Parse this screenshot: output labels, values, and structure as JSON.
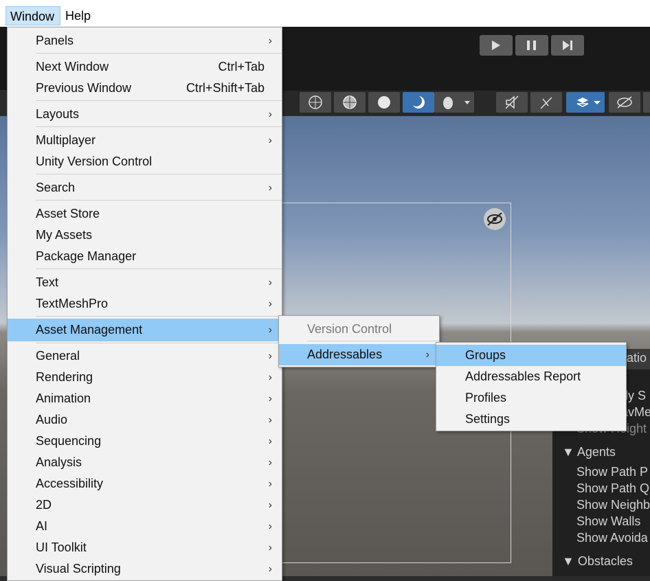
{
  "menubar": {
    "window": "Window",
    "help": "Help"
  },
  "main_menu": {
    "items": [
      {
        "label": "Panels",
        "arrow": "›"
      },
      {
        "label": "Next Window",
        "shortcut": "Ctrl+Tab"
      },
      {
        "label": "Previous Window",
        "shortcut": "Ctrl+Shift+Tab"
      },
      {
        "label": "Layouts",
        "arrow": "›"
      },
      {
        "label": "Multiplayer",
        "arrow": "›"
      },
      {
        "label": "Unity Version Control"
      },
      {
        "label": "Search",
        "arrow": "›"
      },
      {
        "label": "Asset Store"
      },
      {
        "label": "My Assets"
      },
      {
        "label": "Package Manager"
      },
      {
        "label": "Text",
        "arrow": "›"
      },
      {
        "label": "TextMeshPro",
        "arrow": "›"
      },
      {
        "label": "Asset Management",
        "arrow": "›"
      },
      {
        "label": "General",
        "arrow": "›"
      },
      {
        "label": "Rendering",
        "arrow": "›"
      },
      {
        "label": "Animation",
        "arrow": "›"
      },
      {
        "label": "Audio",
        "arrow": "›"
      },
      {
        "label": "Sequencing",
        "arrow": "›"
      },
      {
        "label": "Analysis",
        "arrow": "›"
      },
      {
        "label": "Accessibility",
        "arrow": "›"
      },
      {
        "label": "2D",
        "arrow": "›"
      },
      {
        "label": "AI",
        "arrow": "›"
      },
      {
        "label": "UI Toolkit",
        "arrow": "›"
      },
      {
        "label": "Visual Scripting",
        "arrow": "›"
      }
    ]
  },
  "asset_management_menu": {
    "items": [
      {
        "label": "Version Control"
      },
      {
        "label": "Addressables",
        "arrow": "›"
      }
    ]
  },
  "addressables_menu": {
    "items": [
      {
        "label": "Groups"
      },
      {
        "label": "Addressables Report"
      },
      {
        "label": "Profiles"
      },
      {
        "label": "Settings"
      }
    ]
  },
  "overlay": {
    "title_partial": "atio",
    "row1": "nly S",
    "row2": "avMe",
    "row3": "Show Height",
    "agents_label": "Agents",
    "agents_items": [
      "Show Path P",
      "Show Path Q",
      "Show Neighb",
      "Show Walls",
      "Show Avoida"
    ],
    "obstacles_label": "Obstacles"
  },
  "colors": {
    "menu_bg": "#f2f2f2",
    "highlight": "#91c9f7",
    "menubar_active": "#cce4f7",
    "editor_dark": "#191919"
  }
}
